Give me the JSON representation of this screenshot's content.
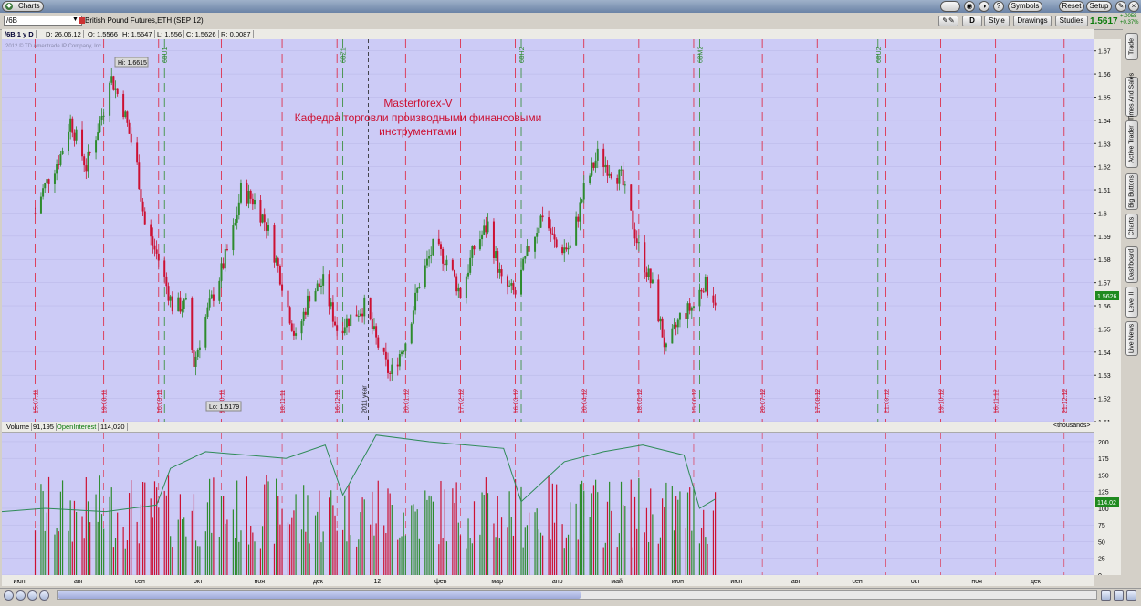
{
  "window": {
    "tab_label": "Charts"
  },
  "toolbar": {
    "symbols_label": "Symbols",
    "reset_label": "Reset",
    "setup_label": "Setup",
    "style_label": "Style",
    "drawings_label": "Drawings",
    "studies_label": "Studies",
    "d_label": "D",
    "last_price": "1.5617",
    "change_top": "+.0058",
    "change_bottom": "+0.37%"
  },
  "symbol": {
    "value": "/6B",
    "description": "British Pound Futures,ETH (SEP 12)"
  },
  "info_bar": {
    "period": "/6B 1 y D",
    "date": "D: 26.06.12",
    "open": "O: 1.5566",
    "high": "H: 1.5647",
    "low": "L: 1.556",
    "close": "C: 1.5626",
    "range": "R: 0.0087"
  },
  "copyright": "2012 © TD Ameritrade IP Company, Inc.",
  "annotation": {
    "line1": "Masterforex-V",
    "line2": "Кафедра торговли производными финансовыми",
    "line3": "инструментами"
  },
  "price_labels": {
    "hi": "Hi: 1.6615",
    "lo": "Lo: 1.5179",
    "current": "1.5626"
  },
  "price_axis": [
    "1.67",
    "1.66",
    "1.65",
    "1.64",
    "1.63",
    "1.62",
    "1.61",
    "1.6",
    "1.59",
    "1.58",
    "1.57",
    "1.56",
    "1.55",
    "1.54",
    "1.53",
    "1.52",
    "1.51"
  ],
  "date_labels": [
    "15.07.11",
    "19.08.11",
    "16.09.11",
    "18.10.11",
    "18.11.11",
    "16.12.11",
    "20.01.12",
    "17.02.12",
    "16.03.12",
    "20.04.12",
    "18.05.12",
    "15.06.12",
    "20.07.12",
    "17.08.12",
    "21.09.12",
    "19.10.12",
    "16.11.12",
    "21.12.12"
  ],
  "year_label": "2011 year",
  "expiry_labels": [
    "6BU1",
    "6BZ1",
    "6BH2",
    "6BM2",
    "6BU2"
  ],
  "volume_bar": {
    "volume_label": "Volume",
    "volume_value": "91,195",
    "oi_label": "OpenInterest",
    "oi_value": "114,020",
    "units": "<thousands>"
  },
  "volume_axis": [
    "200",
    "175",
    "150",
    "125",
    "100",
    "75",
    "50",
    "25",
    "0"
  ],
  "oi_current": "114.02",
  "month_axis": [
    "июл",
    "авг",
    "сен",
    "окт",
    "ноя",
    "дек",
    "12",
    "фев",
    "мар",
    "апр",
    "май",
    "июн",
    "июл",
    "авг",
    "сен",
    "окт",
    "ноя",
    "дек"
  ],
  "sidebar_tabs": [
    "Trade",
    "Times And Sales",
    "Active Trader",
    "Big Buttons",
    "Charts",
    "Dashboard",
    "Level II",
    "Live News"
  ],
  "colors": {
    "background": "#cccbf6",
    "up": "#2e8b2e",
    "down": "#cc1133",
    "oi_line": "#2e8b57",
    "annotation": "#cc1133"
  },
  "chart_data": {
    "type": "candlestick",
    "symbol": "/6B",
    "price_range": [
      1.51,
      1.675
    ],
    "anchors": [
      [
        "15.07.11",
        1.6
      ],
      [
        "19.07.11",
        1.61
      ],
      [
        "28.07.11",
        1.625
      ],
      [
        "02.08.11",
        1.64
      ],
      [
        "10.08.11",
        1.62
      ],
      [
        "19.08.11",
        1.645
      ],
      [
        "22.08.11",
        1.66
      ],
      [
        "29.08.11",
        1.645
      ],
      [
        "05.09.11",
        1.62
      ],
      [
        "09.09.11",
        1.595
      ],
      [
        "16.09.11",
        1.58
      ],
      [
        "23.09.11",
        1.56
      ],
      [
        "30.09.11",
        1.56
      ],
      [
        "04.10.11",
        1.535
      ],
      [
        "10.10.11",
        1.555
      ],
      [
        "18.10.11",
        1.575
      ],
      [
        "25.10.11",
        1.595
      ],
      [
        "28.10.11",
        1.61
      ],
      [
        "04.11.11",
        1.605
      ],
      [
        "10.11.11",
        1.595
      ],
      [
        "18.11.11",
        1.57
      ],
      [
        "25.11.11",
        1.545
      ],
      [
        "02.12.11",
        1.565
      ],
      [
        "09.12.11",
        1.57
      ],
      [
        "16.12.11",
        1.55
      ],
      [
        "23.12.11",
        1.555
      ],
      [
        "30.12.11",
        1.56
      ],
      [
        "05.01.12",
        1.545
      ],
      [
        "12.01.12",
        1.53
      ],
      [
        "20.01.12",
        1.545
      ],
      [
        "27.01.12",
        1.57
      ],
      [
        "03.02.12",
        1.585
      ],
      [
        "10.02.12",
        1.58
      ],
      [
        "17.02.12",
        1.565
      ],
      [
        "24.02.12",
        1.585
      ],
      [
        "02.03.12",
        1.595
      ],
      [
        "09.03.12",
        1.57
      ],
      [
        "16.03.12",
        1.565
      ],
      [
        "23.03.12",
        1.585
      ],
      [
        "30.03.12",
        1.6
      ],
      [
        "06.04.12",
        1.585
      ],
      [
        "13.04.12",
        1.585
      ],
      [
        "20.04.12",
        1.61
      ],
      [
        "27.04.12",
        1.625
      ],
      [
        "02.05.12",
        1.62
      ],
      [
        "09.05.12",
        1.615
      ],
      [
        "18.05.12",
        1.585
      ],
      [
        "25.05.12",
        1.568
      ],
      [
        "01.06.12",
        1.54
      ],
      [
        "08.06.12",
        1.555
      ],
      [
        "15.06.12",
        1.56
      ],
      [
        "20.06.12",
        1.57
      ],
      [
        "26.06.12",
        1.5626
      ]
    ]
  }
}
